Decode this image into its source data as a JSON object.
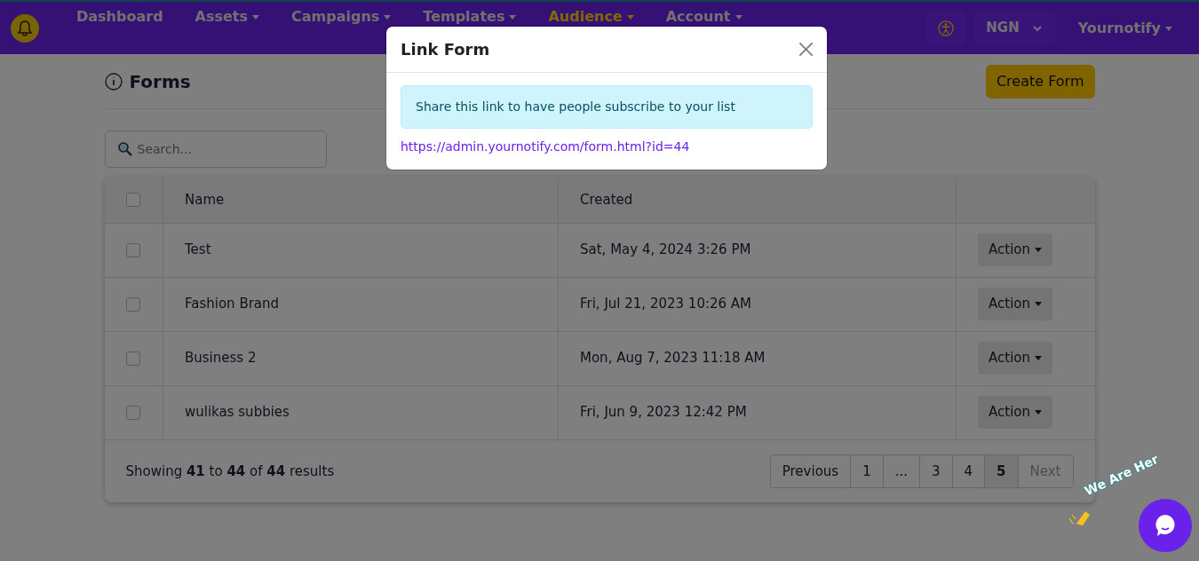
{
  "navbar": {
    "items": [
      {
        "label": "Dashboard",
        "dropdown": false,
        "selected": false
      },
      {
        "label": "Assets",
        "dropdown": true,
        "selected": false
      },
      {
        "label": "Campaigns",
        "dropdown": true,
        "selected": false
      },
      {
        "label": "Templates",
        "dropdown": true,
        "selected": false
      },
      {
        "label": "Audience",
        "dropdown": true,
        "selected": true
      },
      {
        "label": "Account",
        "dropdown": true,
        "selected": false
      }
    ],
    "currency": "NGN",
    "account": "Yournotify"
  },
  "page": {
    "title": "Forms",
    "create_button": "Create Form"
  },
  "search": {
    "placeholder": "Search..."
  },
  "table": {
    "select_all_checked": false,
    "columns": [
      "Name",
      "Created"
    ],
    "rows": [
      {
        "name": "Test",
        "created": "Sat, May 4, 2024 3:26 PM",
        "checked": false,
        "action": "Action"
      },
      {
        "name": "Fashion Brand",
        "created": "Fri, Jul 21, 2023 10:26 AM",
        "checked": false,
        "action": "Action"
      },
      {
        "name": "Business 2",
        "created": "Mon, Aug 7, 2023 11:18 AM",
        "checked": false,
        "action": "Action"
      },
      {
        "name": "wulikas subbies",
        "created": "Fri, Jun 9, 2023 12:42 PM",
        "checked": false,
        "action": "Action"
      }
    ]
  },
  "footer": {
    "summary": "Showing **41** to **44** of **44** results",
    "pagination": [
      {
        "label": "Previous",
        "selected": false,
        "disabled": false
      },
      {
        "label": "1",
        "selected": false,
        "disabled": false
      },
      {
        "label": "...",
        "selected": false,
        "disabled": false
      },
      {
        "label": "3",
        "selected": false,
        "disabled": false
      },
      {
        "label": "4",
        "selected": false,
        "disabled": false
      },
      {
        "label": "5",
        "selected": true,
        "disabled": false
      },
      {
        "label": "Next",
        "selected": false,
        "disabled": true
      }
    ]
  },
  "modal": {
    "title": "Link Form",
    "message": "Share this link to have people subscribe to your list",
    "link": "https://admin.yournotify.com/form.html?id=44"
  },
  "chat_widget": {
    "caption": "We Are Her"
  }
}
